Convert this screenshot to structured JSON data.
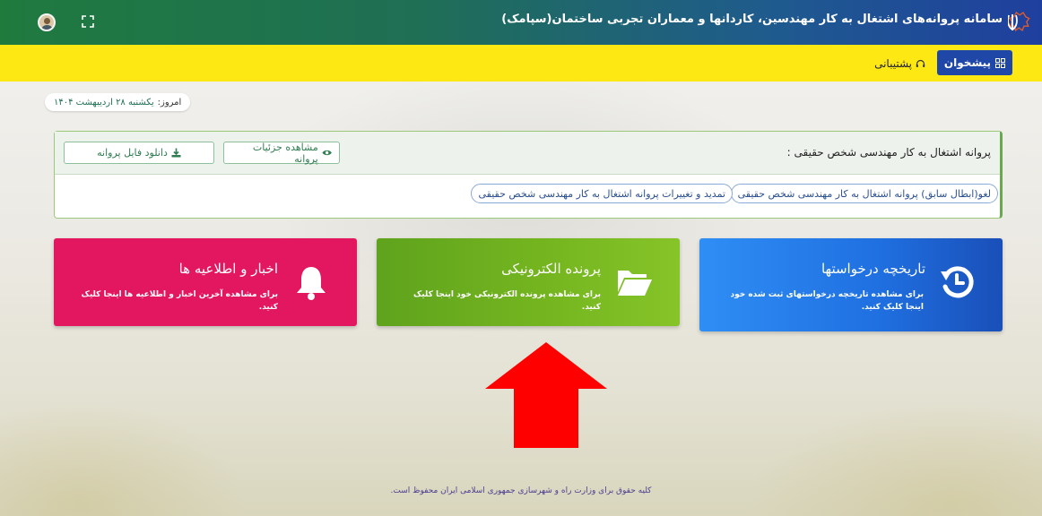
{
  "header": {
    "title": "سامانه پروانه‌های اشتغال به کار مهندسین، کاردانها و معماران تجربی ساختمان(سپامک)",
    "emblem_icon": "iran-emblem-icon",
    "user_icon": "user-avatar-icon",
    "fullscreen_icon": "fullscreen-icon"
  },
  "nav": {
    "dashboard_label": "پیشخوان",
    "support_label": "پشتیبانی"
  },
  "today": {
    "label": "امروز:",
    "value": "یکشنبه ۲۸ اردیبهشت ۱۴۰۴"
  },
  "license": {
    "title": "پروانه اشتغال به کار مهندسی شخص حقیقی :",
    "view_details_label": "مشاهده جزئیات پروانه",
    "download_label": "دانلود فایل پروانه",
    "cancel_link": "لغو(ابطال سابق) پروانه اشتغال به کار مهندسی شخص حقیقی",
    "renew_link": "تمدید و تغییرات پروانه اشتغال به کار مهندسی شخص حقیقی"
  },
  "tiles": {
    "history": {
      "title": "تاریخچه درخواستها",
      "desc": "برای مشاهده تاریخچه درخواستهای ثبت شده خود اینجا کلیک کنید.",
      "color": "#1f6fe0"
    },
    "efile": {
      "title": "پرونده الکترونیکی",
      "desc": "برای مشاهده پرونده الکترونیکی خود اینجا کلیک کنید.",
      "color": "#74b51f"
    },
    "news": {
      "title": "اخبار و اطلاعیه ها",
      "desc": "برای مشاهده آخرین اخبار و اطلاعیه ها اینجا کلیک کنید.",
      "color": "#e3175f"
    }
  },
  "annotation": {
    "arrow_color": "#ff0000"
  },
  "footer": {
    "text": "کلیه حقوق برای وزارت راه و شهرسازی جمهوری اسلامی ایران محفوظ است."
  },
  "colors": {
    "primary_blue": "#1f47a8",
    "yellow_bar": "#fde813",
    "accent_green": "#1f7a3e"
  }
}
